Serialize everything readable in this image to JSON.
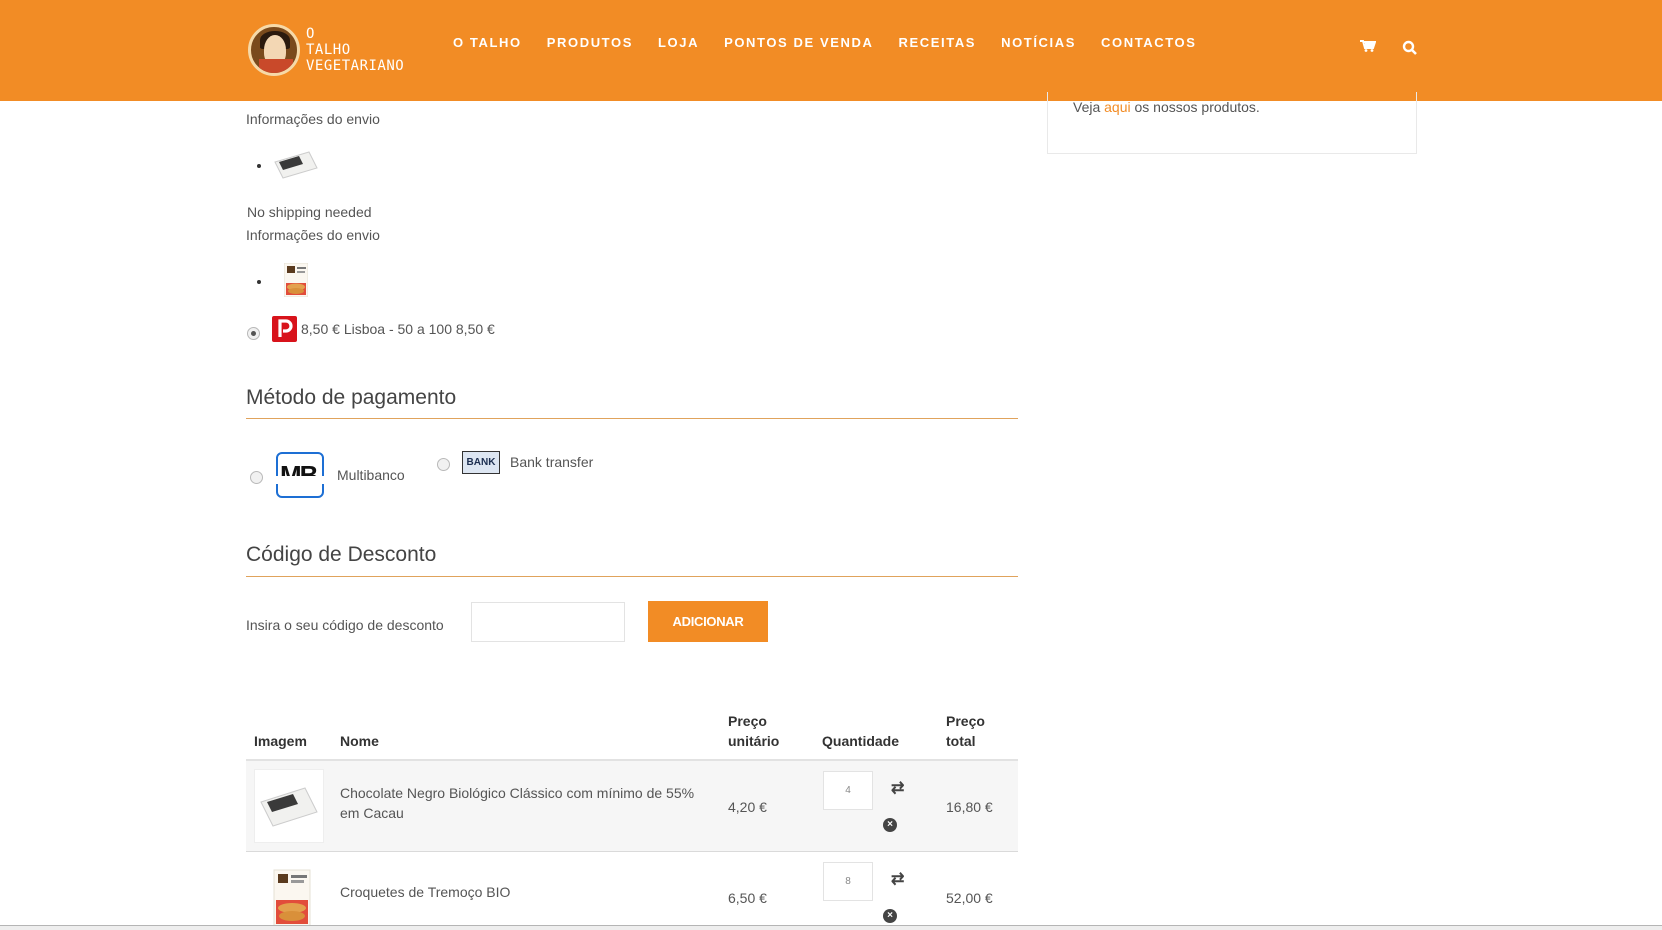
{
  "header": {
    "logo_line1": "O",
    "logo_line2": "TALHO",
    "logo_line3": "VEGETARIANO",
    "nav": [
      "O TALHO",
      "PRODUTOS",
      "LOJA",
      "PONTOS DE VENDA",
      "RECEITAS",
      "NOTÍCIAS",
      "CONTACTOS"
    ],
    "cart_icon": "cart-icon",
    "search_icon": "search-icon"
  },
  "sidebar": {
    "before_link": "Veja ",
    "link": "aqui",
    "after_link": " os nossos produtos."
  },
  "shipping": {
    "info_label_1": "Informações do envio",
    "no_shipping": "No shipping needed",
    "info_label_2": "Informações do envio",
    "option_label": "8,50 € Lisboa - 50 a 100 8,50 €"
  },
  "payment": {
    "title": "Método de pagamento",
    "methods": [
      {
        "logo": "MB",
        "label": "Multibanco"
      },
      {
        "logo": "BANK",
        "label": "Bank transfer"
      }
    ]
  },
  "discount": {
    "title": "Código de Desconto",
    "label": "Insira o seu código de desconto",
    "input_value": "",
    "button": "ADICIONAR"
  },
  "cart_table": {
    "headers": {
      "image": "Imagem",
      "name": "Nome",
      "unit_price_1": "Preço",
      "unit_price_2": "unitário",
      "quantity": "Quantidade",
      "total_1": "Preço",
      "total_2": "total"
    },
    "rows": [
      {
        "name_1": "Chocolate Negro Biológico Clássico com mínimo de 55%",
        "name_2": "em Cacau",
        "unit_price": "4,20 €",
        "quantity": "4",
        "total": "16,80 €"
      },
      {
        "name_1": "Croquetes de Tremoço BIO",
        "name_2": "",
        "unit_price": "6,50 €",
        "quantity": "8",
        "total": "52,00 €"
      }
    ]
  },
  "colors": {
    "brand_orange": "#f28c25",
    "rule": "#e0a35c"
  }
}
